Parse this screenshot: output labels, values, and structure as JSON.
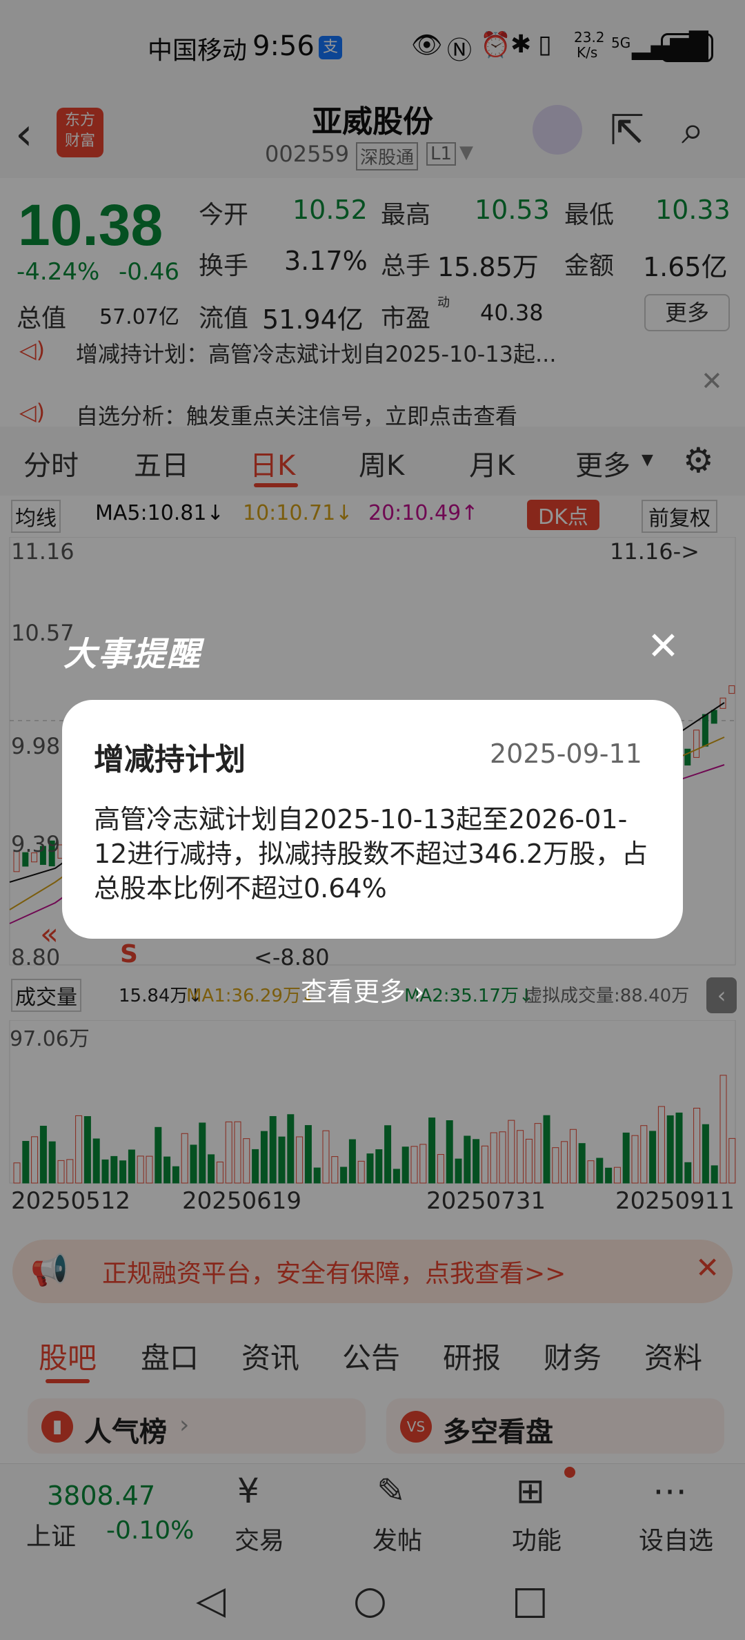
{
  "status": {
    "carrier": "中国移动",
    "time": "9:56",
    "pay": "支",
    "speed_top": "23.2",
    "speed_bottom": "K/s",
    "net": "5G",
    "battery": "70"
  },
  "header": {
    "title": "亚威股份",
    "code": "002559",
    "tag1": "深股通",
    "tag2": "L1",
    "logo_line1": "东方",
    "logo_line2": "财富"
  },
  "quote": {
    "price": "10.38",
    "change_pct": "-4.24%",
    "change": "-0.46",
    "open_label": "今开",
    "open": "10.52",
    "high_label": "最高",
    "high": "10.53",
    "low_label": "最低",
    "low": "10.33",
    "turnover_label": "换手",
    "turnover": "3.17%",
    "volume_label": "总手",
    "volume": "15.85万",
    "amount_label": "金额",
    "amount": "1.65亿",
    "mktcap_label": "总值",
    "mktcap": "57.07亿",
    "float_label": "流值",
    "float": "51.94亿",
    "pe_label": "市盈",
    "pe_sup": "动",
    "pe": "40.38",
    "more": "更多"
  },
  "news": {
    "line1": "增减持计划：高管冷志斌计划自2025-10-13起...",
    "line2": "自选分析：触发重点关注信号，立即点击查看"
  },
  "tabs": {
    "t1": "分时",
    "t2": "五日",
    "t3": "日K",
    "t4": "周K",
    "t5": "月K",
    "t6": "更多"
  },
  "ma": {
    "label": "均线",
    "ma5": "MA5:10.81↓",
    "ma10": "10:10.71↓",
    "ma20": "20:10.49↑",
    "dk": "DK点",
    "adj": "前复权"
  },
  "chart": {
    "y1": "11.16",
    "y2": "10.57",
    "y3": "9.98",
    "y4": "9.39",
    "y5": "8.80",
    "high_mark": "11.16->",
    "low_mark": "<-8.80",
    "sell": "S"
  },
  "vol": {
    "label": "成交量",
    "v": "15.84万↓",
    "ma1": "MA1:36.29万↓",
    "ma2": "MA2:35.17万↓",
    "virtual": "虚拟成交量:88.40万",
    "max": "97.06万"
  },
  "dates": {
    "d1": "20250512",
    "d2": "20250619",
    "d3": "20250731",
    "d4": "20250911"
  },
  "ad": {
    "text": "正规融资平台，安全有保障，点我查看>>"
  },
  "btabs": {
    "b1": "股吧",
    "b2": "盘口",
    "b3": "资讯",
    "b4": "公告",
    "b5": "研报",
    "b6": "财务",
    "b7": "资料"
  },
  "cards": {
    "c1": "人气榜",
    "c2": "多空看盘"
  },
  "nav": {
    "index_value": "3808.47",
    "index_name": "上证",
    "index_change": "-0.10%",
    "trade": "交易",
    "post": "发帖",
    "func": "功能",
    "fav": "设自选"
  },
  "modal": {
    "banner": "大事提醒",
    "title": "增减持计划",
    "date": "2025-09-11",
    "body": "高管冷志斌计划自2025-10-13起至2026-01-12进行减持，拟减持股数不超过346.2万股，占总股本比例不超过0.64%",
    "more": "查看更多"
  }
}
